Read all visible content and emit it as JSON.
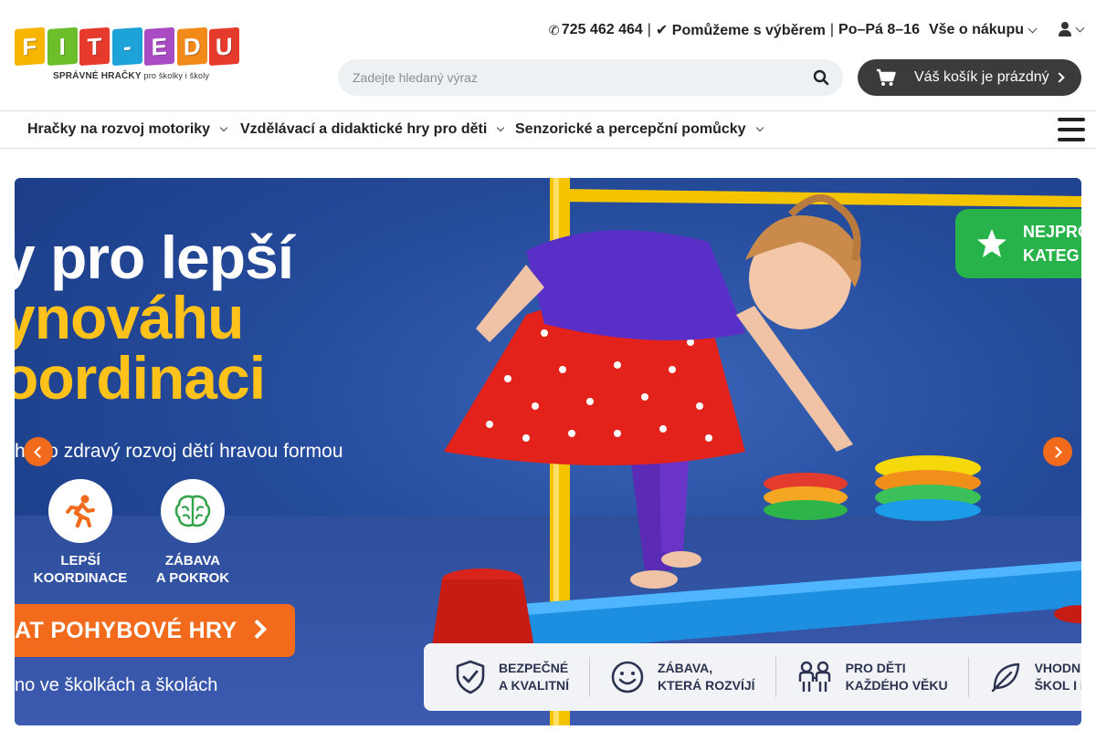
{
  "logo": {
    "letters": [
      "F",
      "I",
      "T",
      "-",
      "E",
      "D",
      "U"
    ],
    "letter_colors": [
      "#f7b500",
      "#6cbf2a",
      "#e63a2c",
      "#1ea3d9",
      "#a94cc4",
      "#f28a1a",
      "#e63a2c"
    ],
    "tagline": "SPRÁVNÉ HRAČKY",
    "tagline_small": "pro školky i školy"
  },
  "header": {
    "phone_icon": "phone-icon",
    "phone": "725 462 464",
    "separator": "|",
    "help_text": "✔ Pomůžeme s výběrem",
    "hours": "Po–Pá 8–16",
    "about_menu": "Vše o nákupu"
  },
  "search": {
    "placeholder": "Zadejte hledaný výraz",
    "icon": "search-icon"
  },
  "cart": {
    "icon": "cart-icon",
    "label": "Váš košík je prázdný"
  },
  "nav": {
    "items": [
      {
        "label": "Hračky na rozvoj motoriky"
      },
      {
        "label": "Vzdělávací a didaktické hry pro děti"
      },
      {
        "label": "Senzorické a percepční pomůcky"
      }
    ]
  },
  "banner": {
    "headline_1": "y pro lepší",
    "headline_2": "ynováhu",
    "headline_3": "oordinaci",
    "subline": "h pro zdravý rozvoj dětí hravou formou",
    "features": [
      {
        "icon": "running-person-icon",
        "line1": "LEPŠÍ",
        "line2": "KOORDINACE"
      },
      {
        "icon": "brain-icon",
        "line1": "ZÁBAVA",
        "line2": "A POKROK"
      }
    ],
    "cta_label": "AT POHYBOVÉ HRY",
    "footnote": "no ve školkách a školách",
    "badge_line1": "NEJPRO",
    "badge_line2": "KATEG",
    "strip": [
      {
        "icon": "shield-check-icon",
        "line1": "BEZPEČNÉ",
        "line2": "A KVALITNÍ"
      },
      {
        "icon": "smiley-icon",
        "line1": "ZÁBAVA,",
        "line2": "KTERÁ ROZVÍJÍ"
      },
      {
        "icon": "family-icon",
        "line1": "PRO DĚTI",
        "line2": "KAŽDÉHO VĚKU"
      },
      {
        "icon": "leaf-icon",
        "line1": "VHODNÉ PRO",
        "line2": "ŠKOL I DO"
      }
    ]
  },
  "colors": {
    "accent": "#f26a1b",
    "banner_blue": "#244a9a",
    "headline_yellow": "#ffc21a",
    "badge_green": "#28b34a",
    "cart_bg": "#3b3b3b"
  }
}
